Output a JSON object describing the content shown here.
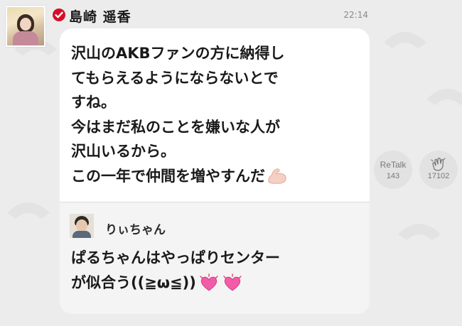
{
  "header": {
    "sender_name": "島崎 遥香",
    "timestamp": "22:14",
    "verified_color": "#d40f2a"
  },
  "message": {
    "lines": [
      "沢山のAKBファンの方に納得し",
      "てもらえるようにならないとで",
      "すね。",
      "今はまだ私のことを嫌いな人が",
      "沢山いるから。",
      "この一年で仲間を増やすんだ"
    ],
    "emoji": "flexed-biceps"
  },
  "reply": {
    "user_name": "りぃちゃん",
    "lines": [
      "ぱるちゃんはやっぱりセンター",
      "が似合う((≧ω≦))"
    ],
    "emoji": [
      "pink-heart",
      "pink-heart"
    ]
  },
  "actions": {
    "retalk_label": "ReTalk",
    "retalk_count": "143",
    "clap_count": "17102"
  }
}
